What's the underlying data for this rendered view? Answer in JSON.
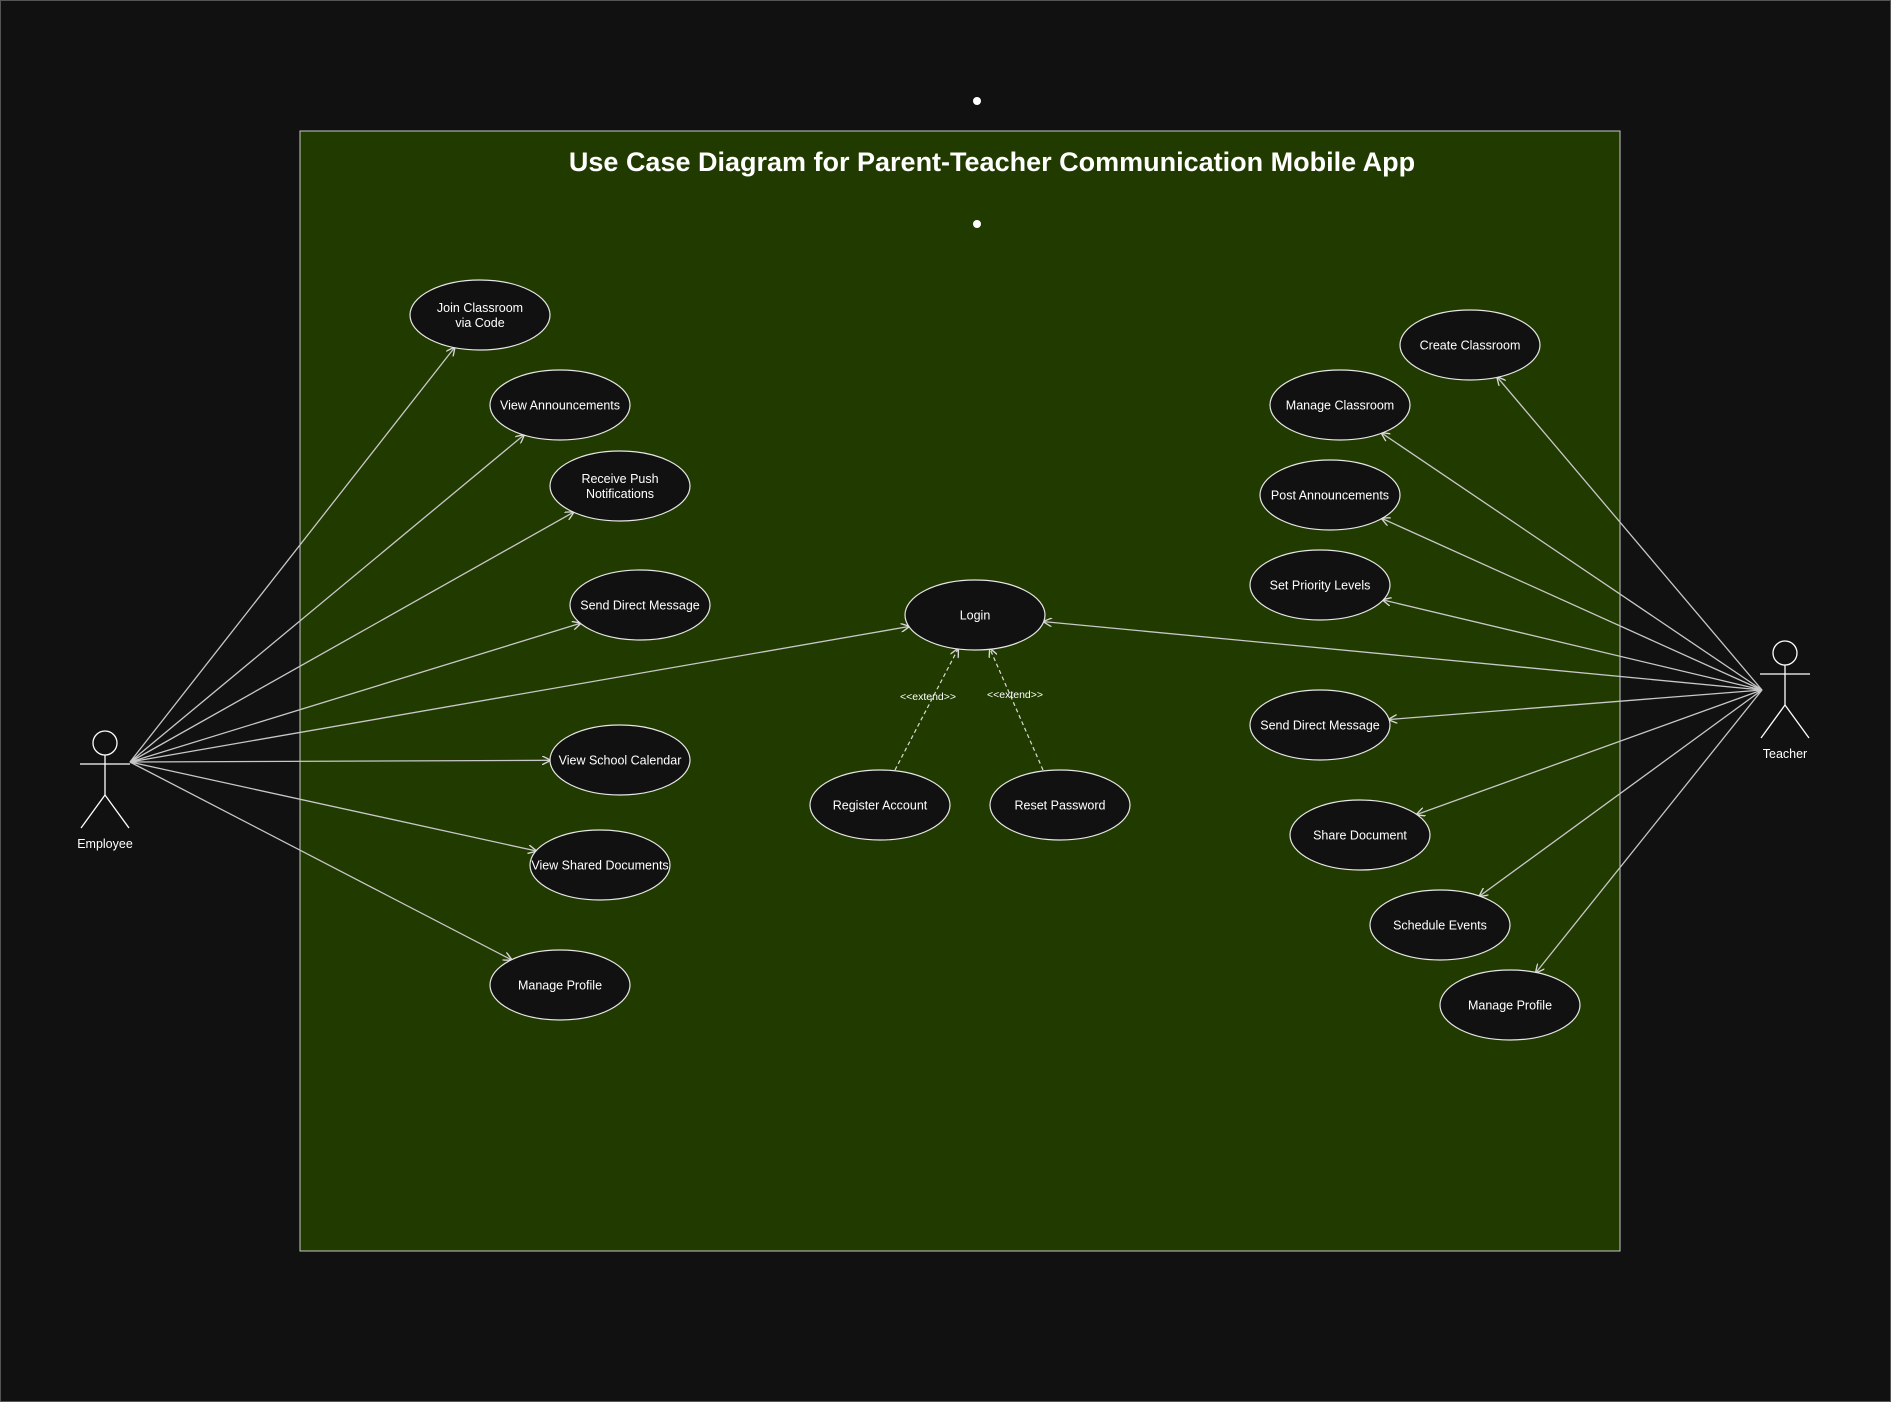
{
  "diagram": {
    "title": "Use Case Diagram for Parent-Teacher Communication Mobile App",
    "colors": {
      "background": "#111111",
      "boundary_fill": "#213a00",
      "boundary_stroke": "#c8c8c8",
      "use_case_fill": "#111111",
      "line": "#c8c8c8",
      "text": "#ffffff"
    },
    "actors": [
      {
        "id": "employee",
        "label": "Employee"
      },
      {
        "id": "teacher",
        "label": "Teacher"
      }
    ],
    "use_cases": [
      {
        "id": "join_classroom",
        "label": "Join Classroom via Code"
      },
      {
        "id": "view_announcements",
        "label": "View Announcements"
      },
      {
        "id": "receive_push",
        "label": "Receive Push Notifications"
      },
      {
        "id": "emp_send_dm",
        "label": "Send Direct Message"
      },
      {
        "id": "view_calendar",
        "label": "View School Calendar"
      },
      {
        "id": "view_shared_docs",
        "label": "View Shared Documents"
      },
      {
        "id": "emp_manage_profile",
        "label": "Manage Profile"
      },
      {
        "id": "login",
        "label": "Login"
      },
      {
        "id": "register",
        "label": "Register Account"
      },
      {
        "id": "reset_password",
        "label": "Reset Password"
      },
      {
        "id": "create_classroom",
        "label": "Create Classroom"
      },
      {
        "id": "manage_classroom",
        "label": "Manage Classroom"
      },
      {
        "id": "post_announcements",
        "label": "Post Announcements"
      },
      {
        "id": "set_priority",
        "label": "Set Priority Levels"
      },
      {
        "id": "teach_send_dm",
        "label": "Send Direct Message"
      },
      {
        "id": "share_document",
        "label": "Share Document"
      },
      {
        "id": "schedule_events",
        "label": "Schedule Events"
      },
      {
        "id": "teach_manage_profile",
        "label": "Manage Profile"
      }
    ],
    "associations": [
      {
        "from": "employee",
        "to": "join_classroom"
      },
      {
        "from": "employee",
        "to": "view_announcements"
      },
      {
        "from": "employee",
        "to": "receive_push"
      },
      {
        "from": "employee",
        "to": "emp_send_dm"
      },
      {
        "from": "employee",
        "to": "login"
      },
      {
        "from": "employee",
        "to": "view_calendar"
      },
      {
        "from": "employee",
        "to": "view_shared_docs"
      },
      {
        "from": "employee",
        "to": "emp_manage_profile"
      },
      {
        "from": "teacher",
        "to": "create_classroom"
      },
      {
        "from": "teacher",
        "to": "manage_classroom"
      },
      {
        "from": "teacher",
        "to": "post_announcements"
      },
      {
        "from": "teacher",
        "to": "set_priority"
      },
      {
        "from": "teacher",
        "to": "login"
      },
      {
        "from": "teacher",
        "to": "teach_send_dm"
      },
      {
        "from": "teacher",
        "to": "share_document"
      },
      {
        "from": "teacher",
        "to": "schedule_events"
      },
      {
        "from": "teacher",
        "to": "teach_manage_profile"
      }
    ],
    "extends": [
      {
        "from": "register",
        "to": "login",
        "label": "<<extend>>"
      },
      {
        "from": "reset_password",
        "to": "login",
        "label": "<<extend>>"
      }
    ]
  }
}
